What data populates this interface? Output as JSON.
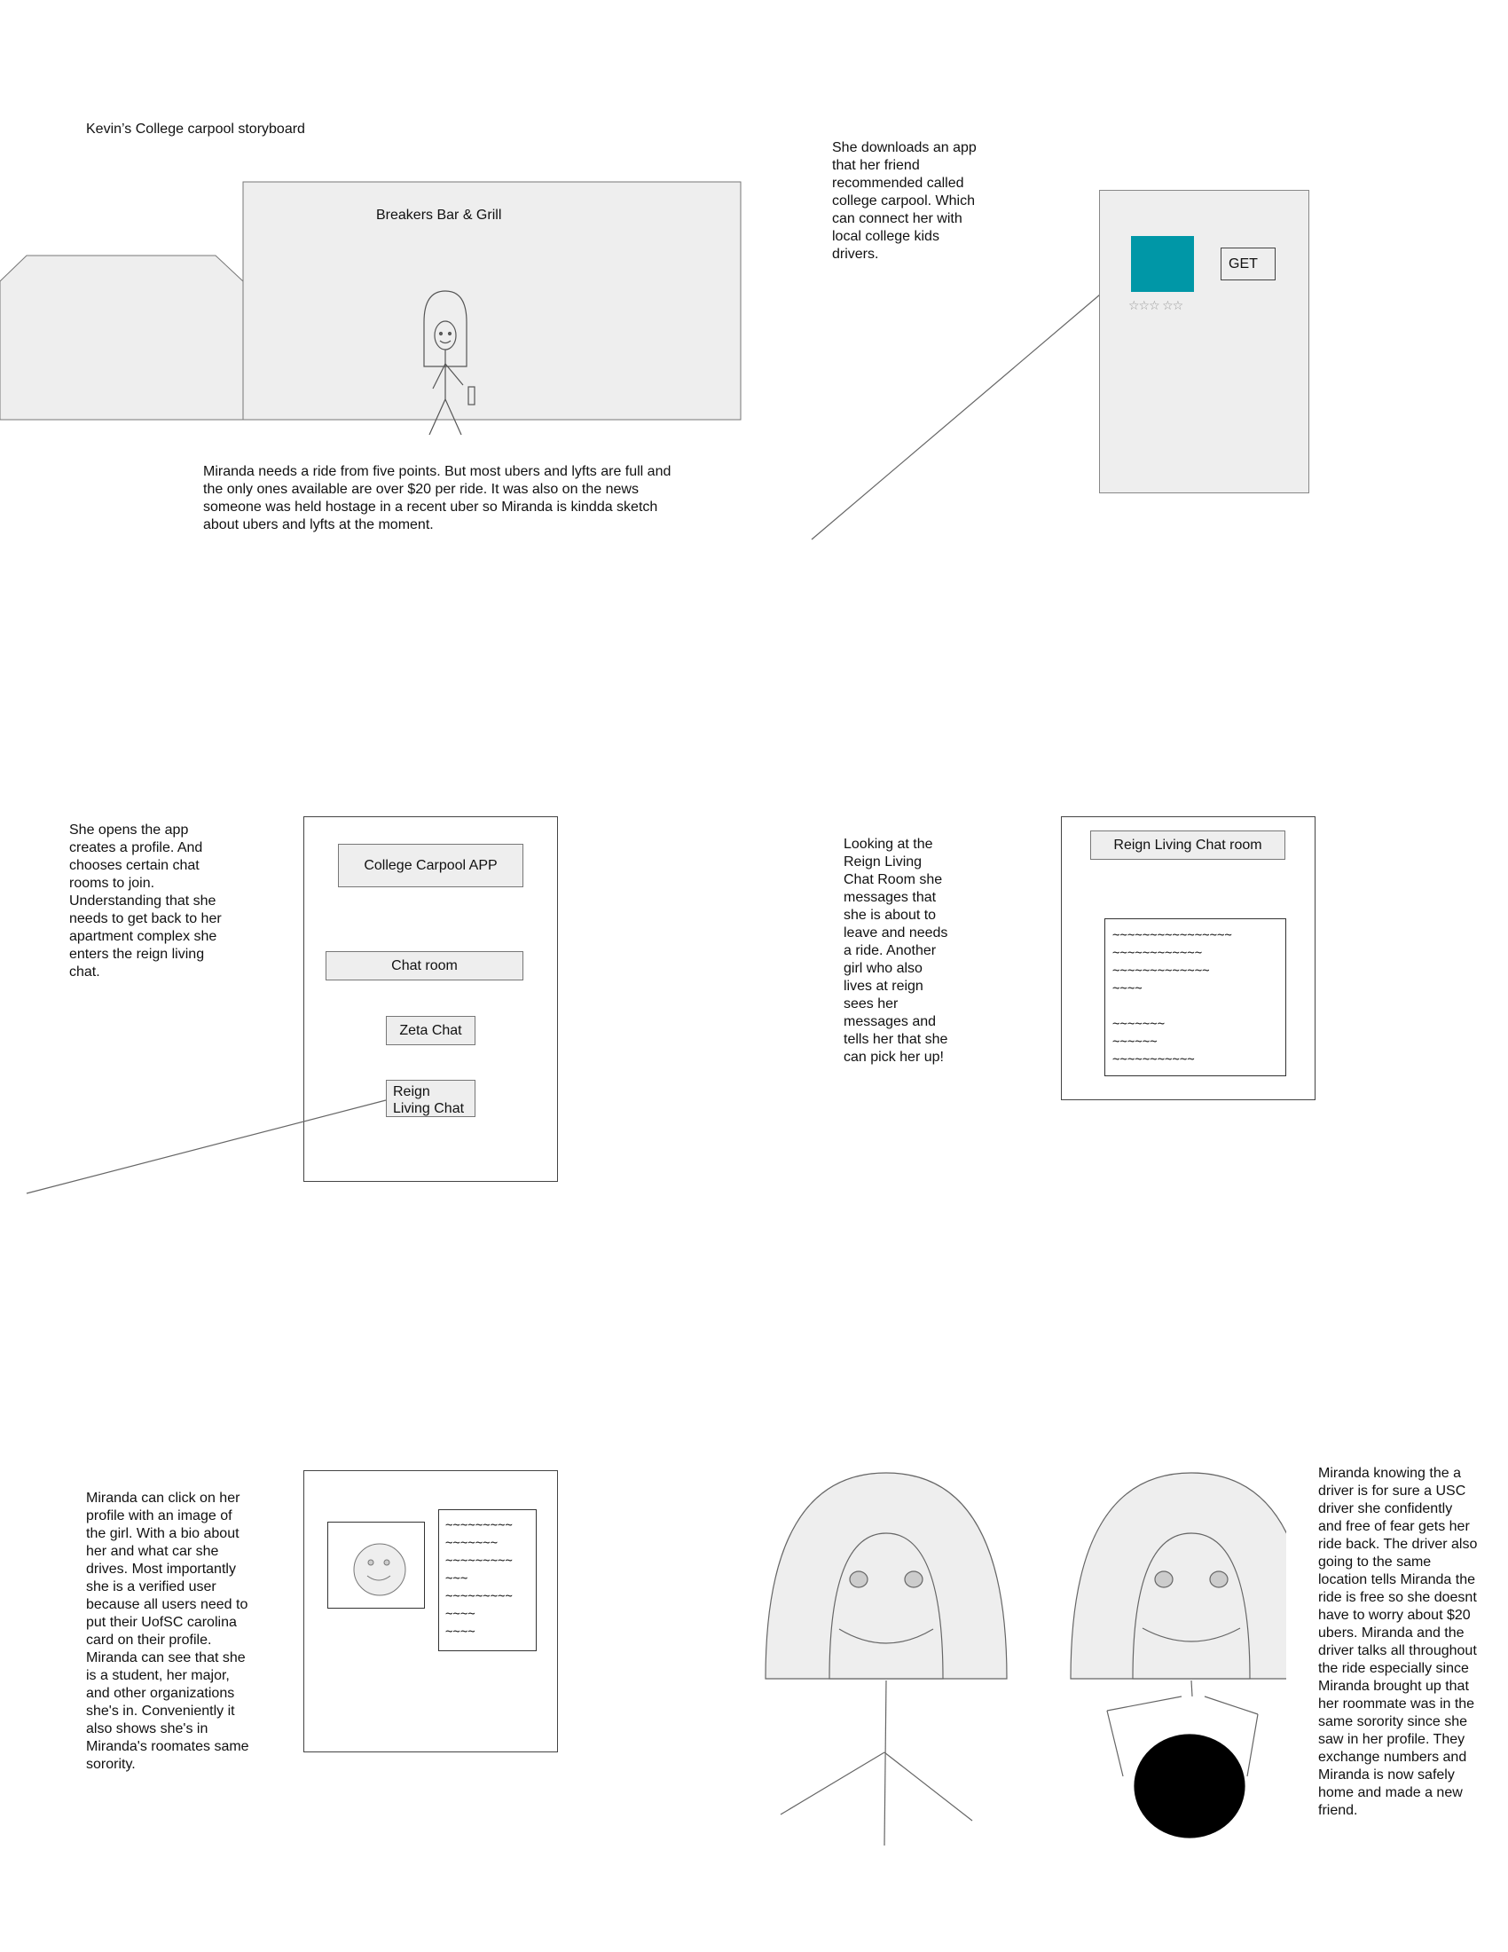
{
  "title": "Kevin’s College carpool storyboard",
  "scene1": {
    "building_sign": "Breakers Bar & Grill",
    "caption": "Miranda needs a ride from five points. But most ubers and lyfts are full and\nthe only ones available are over $20 per ride. It was also on the news\nsomeone was held hostage in a recent uber so Miranda is kindda sketch\nabout ubers and lyfts at the moment."
  },
  "scene2": {
    "caption": "She downloads an app\nthat her friend\nrecommended called\ncollege carpool. Which\ncan connect her with\nlocal college kids\ndrivers.",
    "app_icon_color": "#0097a7",
    "get_button": "GET",
    "rating_stars": "☆☆☆ ☆☆"
  },
  "scene3": {
    "caption": "She opens the app\ncreates a profile. And\nchooses certain chat\nrooms to join.\nUnderstanding that she\nneeds to get back to her\napartment complex she\nenters the reign living\nchat.",
    "app_title": "College Carpool APP",
    "chat_room_label": "Chat room",
    "zeta_chat": "Zeta Chat",
    "reign_chat": "Reign\nLiving Chat"
  },
  "scene4": {
    "caption": "Looking at the\nReign Living\nChat Room she\nmessages that\nshe is about to\nleave and needs\na ride. Another\ngirl who also\nlives at reign\nsees her\nmessages and\ntells her that she\ncan pick her up!",
    "chat_title": "Reign Living Chat room",
    "messages": "~~~~~~~~~~~~~~~~\n~~~~~~~~~~~~\n~~~~~~~~~~~~~\n~~~~\n\n~~~~~~~\n~~~~~~\n~~~~~~~~~~~"
  },
  "scene5": {
    "caption": "Miranda can click on her\nprofile with an image of\nthe girl. With a bio about\nher and what car she\ndrives. Most importantly\nshe is a verified user\nbecause all users need to\nput their UofSC carolina\ncard on their profile.\nMiranda can see that she\nis a student, her major,\nand other organizations\nshe's in. Conveniently it\nalso shows she's in\nMiranda's roomates same\nsorority.",
    "bio": "~~~~~~~~~\n~~~~~~~\n~~~~~~~~~\n~~~\n~~~~~~~~~\n~~~~\n~~~~"
  },
  "scene6": {
    "caption": "Miranda knowing the a\ndriver is for sure a USC\ndriver she confidently\nand free of fear gets her\nride back. The driver also\ngoing to the same\nlocation tells Miranda the\nride is free so she doesnt\nhave to worry about $20\nubers. Miranda and the\ndriver talks all throughout\nthe ride especially since\nMiranda brought up that\nher roommate was in the\nsame sorority since she\nsaw in her profile. They\nexchange numbers and\nMiranda is now safely\nhome and made a new\nfriend."
  }
}
